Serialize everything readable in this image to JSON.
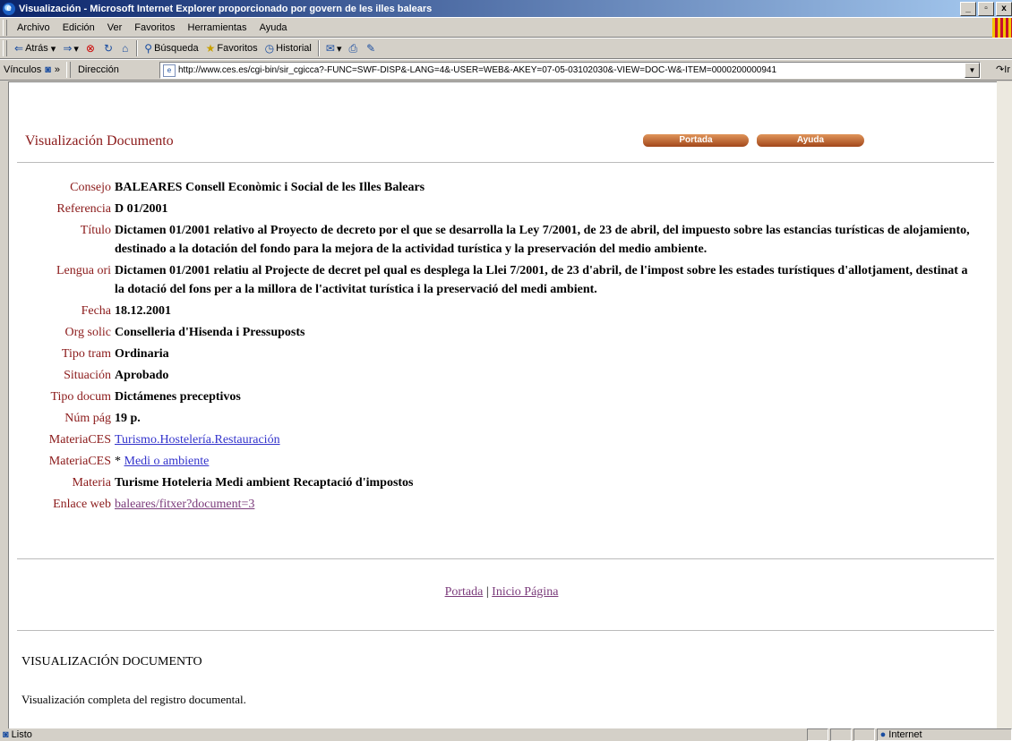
{
  "window": {
    "title": "Visualización - Microsoft Internet Explorer proporcionado por govern de les illes balears",
    "controls": [
      "_",
      "▫",
      "x"
    ]
  },
  "menu": [
    "Archivo",
    "Edición",
    "Ver",
    "Favoritos",
    "Herramientas",
    "Ayuda"
  ],
  "toolbar": {
    "back": "Atrás",
    "search": "Búsqueda",
    "favorites": "Favoritos",
    "history": "Historial"
  },
  "address": {
    "links_label": "Vínculos",
    "chevron": "»",
    "label": "Dirección",
    "url": "http://www.ces.es/cgi-bin/sir_cgicca?-FUNC=SWF-DISP&-LANG=4&-USER=WEB&-AKEY=07-05-03102030&-VIEW=DOC-W&-ITEM=0000200000941",
    "go": "Ir"
  },
  "page": {
    "title": "Visualización Documento",
    "buttons": {
      "portada": "Portada",
      "ayuda": "Ayuda"
    },
    "fields": [
      {
        "label": "Consejo",
        "value": "BALEARES Consell Econòmic i Social de les Illes Balears"
      },
      {
        "label": "Referencia",
        "value": "D 01/2001"
      },
      {
        "label": "Título",
        "value": "Dictamen 01/2001 relativo al Proyecto de decreto por el que se desarrolla la Ley 7/2001, de 23 de abril, del impuesto sobre las estancias turísticas de alojamiento, destinado a la dotación del fondo para la mejora de la actividad turística y la preservación del medio ambiente."
      },
      {
        "label": "Lengua ori",
        "value": "Dictamen 01/2001 relatiu al Projecte de decret pel qual es desplega la Llei 7/2001, de 23 d'abril, de l'impost sobre les estades turístiques d'allotjament, destinat a la dotació del fons per a la millora de l'activitat turística i la preservació del medi ambient."
      },
      {
        "label": "Fecha",
        "value": "18.12.2001"
      },
      {
        "label": "Org solic",
        "value": "Conselleria d'Hisenda i Pressuposts"
      },
      {
        "label": "Tipo tram",
        "value": "Ordinaria"
      },
      {
        "label": "Situación",
        "value": "Aprobado"
      },
      {
        "label": "Tipo docum",
        "value": "Dictámenes preceptivos"
      },
      {
        "label": "Núm pág",
        "value": "19 p."
      }
    ],
    "materia1": {
      "label": "MateriaCES",
      "link": "Turismo.Hostelería.Restauración"
    },
    "materia2": {
      "label": "MateriaCES",
      "prefix": "* ",
      "link": "Medi o ambiente"
    },
    "materia": {
      "label": "Materia",
      "value": "Turisme Hoteleria Medi ambient Recaptació d'impostos"
    },
    "enlace": {
      "label": "Enlace web",
      "link": "baleares/fitxer?document=3"
    },
    "footer": {
      "portada": "Portada",
      "sep": " | ",
      "inicio": "Inicio Página"
    },
    "section_title": "VISUALIZACIÓN DOCUMENTO",
    "section_text": "Visualización completa del registro documental."
  },
  "status": {
    "text": "Listo",
    "zone": "Internet"
  }
}
